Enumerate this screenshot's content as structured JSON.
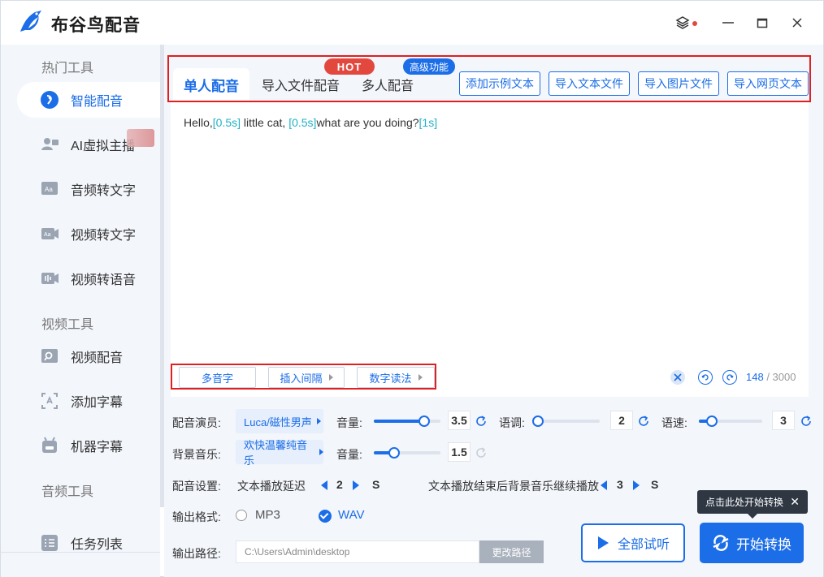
{
  "app": {
    "title": "布谷鸟配音"
  },
  "sidebar": {
    "sections": [
      "热门工具",
      "视频工具",
      "音频工具"
    ],
    "items": [
      {
        "label": "智能配音",
        "icon": "voice-icon",
        "active": true
      },
      {
        "label": "AI虚拟主播",
        "icon": "avatar-host-icon"
      },
      {
        "label": "音频转文字",
        "icon": "audio-text-icon"
      },
      {
        "label": "视频转文字",
        "icon": "video-text-icon"
      },
      {
        "label": "视频转语音",
        "icon": "video-audio-icon"
      },
      {
        "label": "视频配音",
        "icon": "video-dub-icon"
      },
      {
        "label": "添加字幕",
        "icon": "subtitle-icon"
      },
      {
        "label": "机器字幕",
        "icon": "robot-icon"
      }
    ],
    "footer_item": {
      "label": "任务列表",
      "icon": "task-list-icon"
    }
  },
  "tabs": [
    {
      "label": "单人配音",
      "active": true
    },
    {
      "label": "导入文件配音"
    },
    {
      "label": "多人配音"
    }
  ],
  "badges": {
    "hot": "HOT",
    "pro": "高级功能"
  },
  "import_buttons": [
    "添加示例文本",
    "导入文本文件",
    "导入图片文件",
    "导入网页文本"
  ],
  "editor": {
    "segments": [
      {
        "text": "Hello,",
        "tag": false
      },
      {
        "text": "[0.5s]",
        "tag": true
      },
      {
        "text": " little cat, ",
        "tag": false
      },
      {
        "text": "[0.5s]",
        "tag": true
      },
      {
        "text": "what are you doing?",
        "tag": false
      },
      {
        "text": "[1s]",
        "tag": true
      }
    ],
    "count": "148",
    "max": " / 3000"
  },
  "tools": [
    "多音字",
    "插入间隔",
    "数字读法"
  ],
  "settings": {
    "voice_label": "配音演员:",
    "voice_value": "Luca/磁性男声",
    "volume_label": "音量:",
    "volume_value": "3.5",
    "volume_level": 0.75,
    "pitch_label": "语调:",
    "pitch_value": "2",
    "pitch_level": 0.0,
    "speed_label": "语速:",
    "speed_value": "3",
    "speed_level": 0.2,
    "bgm_label": "背景音乐:",
    "bgm_value": "欢快温馨纯音乐",
    "bgm_volume_label": "音量:",
    "bgm_volume_value": "1.5",
    "bgm_volume_level": 0.3,
    "dub_settings_label": "配音设置:",
    "delay_label": "文本播放延迟",
    "delay_value": "2",
    "delay_unit": "S",
    "bgm_continue_label": "文本播放结束后背景音乐继续播放",
    "bgm_continue_value": "3",
    "bgm_continue_unit": "S",
    "format_label": "输出格式:",
    "format_options": [
      "MP3",
      "WAV"
    ],
    "format_selected": "WAV",
    "path_label": "输出路径:",
    "path_value": "C:\\Users\\Admin\\desktop",
    "path_button": "更改路径"
  },
  "actions": {
    "preview": "全部试听",
    "start": "开始转换",
    "tooltip": "点击此处开始转换"
  },
  "colors": {
    "accent": "#1b6de8",
    "tag": "#1fb2c6",
    "hot": "#e3483f",
    "highlight_box": "#e02020"
  }
}
